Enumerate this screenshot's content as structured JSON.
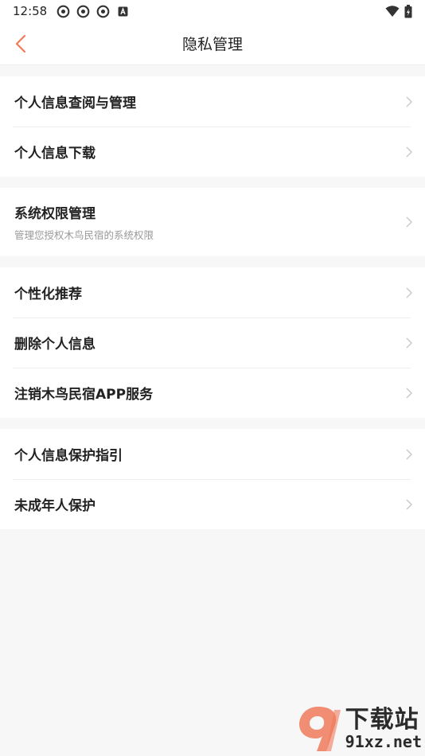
{
  "status_bar": {
    "time": "12:58"
  },
  "header": {
    "title": "隐私管理"
  },
  "groups": [
    {
      "items": [
        {
          "label": "个人信息查阅与管理"
        },
        {
          "label": "个人信息下载"
        }
      ]
    },
    {
      "items": [
        {
          "label": "系统权限管理",
          "sub": "管理您授权木鸟民宿的系统权限"
        }
      ]
    },
    {
      "items": [
        {
          "label": "个性化推荐"
        },
        {
          "label": "删除个人信息"
        },
        {
          "label": "注销木鸟民宿APP服务"
        }
      ]
    },
    {
      "items": [
        {
          "label": "个人信息保护指引"
        },
        {
          "label": "未成年人保护"
        }
      ]
    }
  ],
  "watermark": {
    "cn": "下载站",
    "en": "91xz.net"
  },
  "colors": {
    "accent": "#f07a5a",
    "background": "#f7f7f7",
    "chevron": "#c8c8c8"
  }
}
